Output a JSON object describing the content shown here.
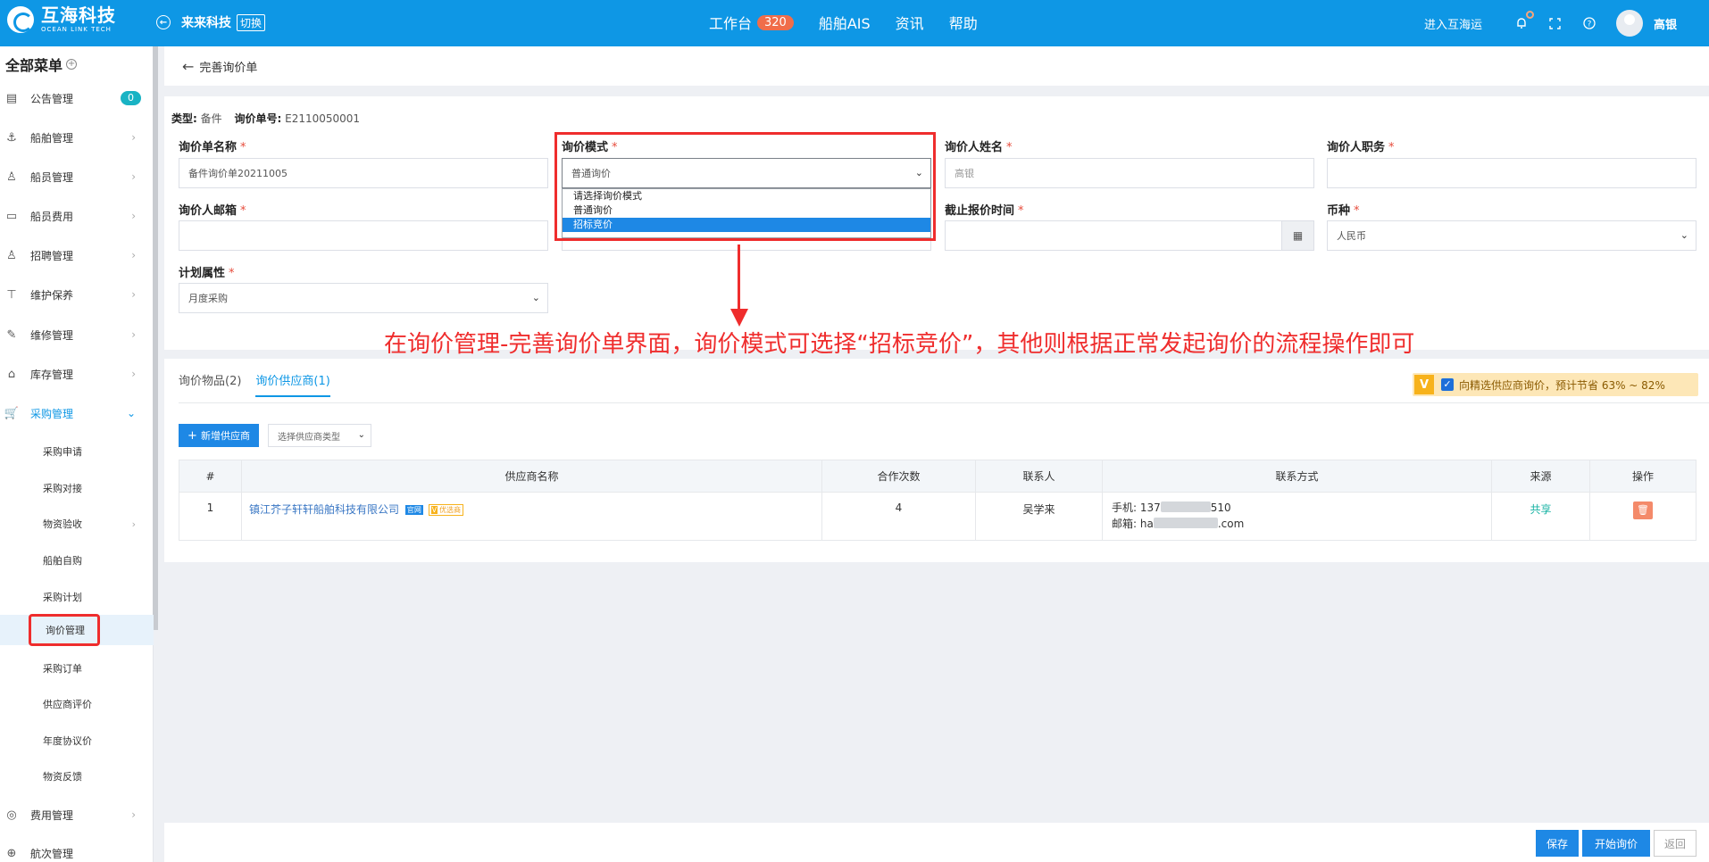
{
  "brand": {
    "name_cn": "互海科技",
    "name_en": "OCEAN LINK TECH"
  },
  "company": {
    "name": "来来科技",
    "switch_label": "切换"
  },
  "topnav": {
    "items": [
      {
        "label": "工作台",
        "badge": "320"
      },
      {
        "label": "船舶AIS"
      },
      {
        "label": "资讯"
      },
      {
        "label": "帮助"
      }
    ]
  },
  "topright": {
    "enter_label": "进入互海运",
    "username": "高银"
  },
  "sidebar": {
    "title": "全部菜单",
    "items": [
      {
        "label": "公告管理",
        "icon": "book-icon",
        "count": "0"
      },
      {
        "label": "船舶管理",
        "icon": "anchor-icon"
      },
      {
        "label": "船员管理",
        "icon": "user-icon"
      },
      {
        "label": "船员费用",
        "icon": "wallet-icon"
      },
      {
        "label": "招聘管理",
        "icon": "user-search-icon"
      },
      {
        "label": "维护保养",
        "icon": "brush-icon"
      },
      {
        "label": "维修管理",
        "icon": "wrench-icon"
      },
      {
        "label": "库存管理",
        "icon": "home-icon"
      },
      {
        "label": "采购管理",
        "icon": "cart-icon"
      }
    ],
    "sub_items": [
      "采购申请",
      "采购对接",
      "物资验收",
      "船舶自购",
      "采购计划",
      "询价管理",
      "采购订单",
      "供应商评价",
      "年度协议价",
      "物资反馈"
    ],
    "bottom_items": [
      {
        "label": "费用管理",
        "icon": "coins-icon"
      },
      {
        "label": "航次管理",
        "icon": "globe-icon"
      }
    ]
  },
  "page": {
    "title": "完善询价单"
  },
  "meta": {
    "type_label": "类型:",
    "type_value": "备件",
    "no_label": "询价单号:",
    "no_value": "E2110050001"
  },
  "form": {
    "name_label": "询价单名称",
    "name_value": "备件询价单20211005",
    "mode_label": "询价模式",
    "mode_value": "普通询价",
    "mode_options": [
      "请选择询价模式",
      "普通询价",
      "招标竞价"
    ],
    "inquirer_label": "询价人姓名",
    "inquirer_placeholder": "高银",
    "position_label": "询价人职务",
    "email_label": "询价人邮箱",
    "deadline_label": "截止报价时间",
    "currency_label": "币种",
    "currency_value": "人民币",
    "plan_label": "计划属性",
    "plan_value": "月度采购"
  },
  "annotation": {
    "text": "在询价管理-完善询价单界面，询价模式可选择“招标竞价”，其他则根据正常发起询价的流程操作即可"
  },
  "tabs": [
    {
      "label": "询价物品(2)"
    },
    {
      "label": "询价供应商(1)"
    }
  ],
  "promo": {
    "v": "V",
    "text": "向精选供应商询价，预计节省 63% ~ 82%"
  },
  "toolbar": {
    "add_label": "新增供应商",
    "type_placeholder": "选择供应商类型"
  },
  "table": {
    "headers": [
      "#",
      "供应商名称",
      "合作次数",
      "联系人",
      "联系方式",
      "来源",
      "操作"
    ],
    "rows": [
      {
        "index": "1",
        "name": "镇江芥子轩轩船舶科技有限公司",
        "tag1": "官网",
        "tag2": "优选商",
        "count": "4",
        "contact": "吴学来",
        "phone_label": "手机:",
        "phone_a": "137",
        "phone_b": "510",
        "email_label": "邮箱:",
        "email_a": "ha",
        "email_b": ".com",
        "source": "共享"
      }
    ]
  },
  "buttons": {
    "save": "保存",
    "start": "开始询价",
    "back": "返回"
  }
}
